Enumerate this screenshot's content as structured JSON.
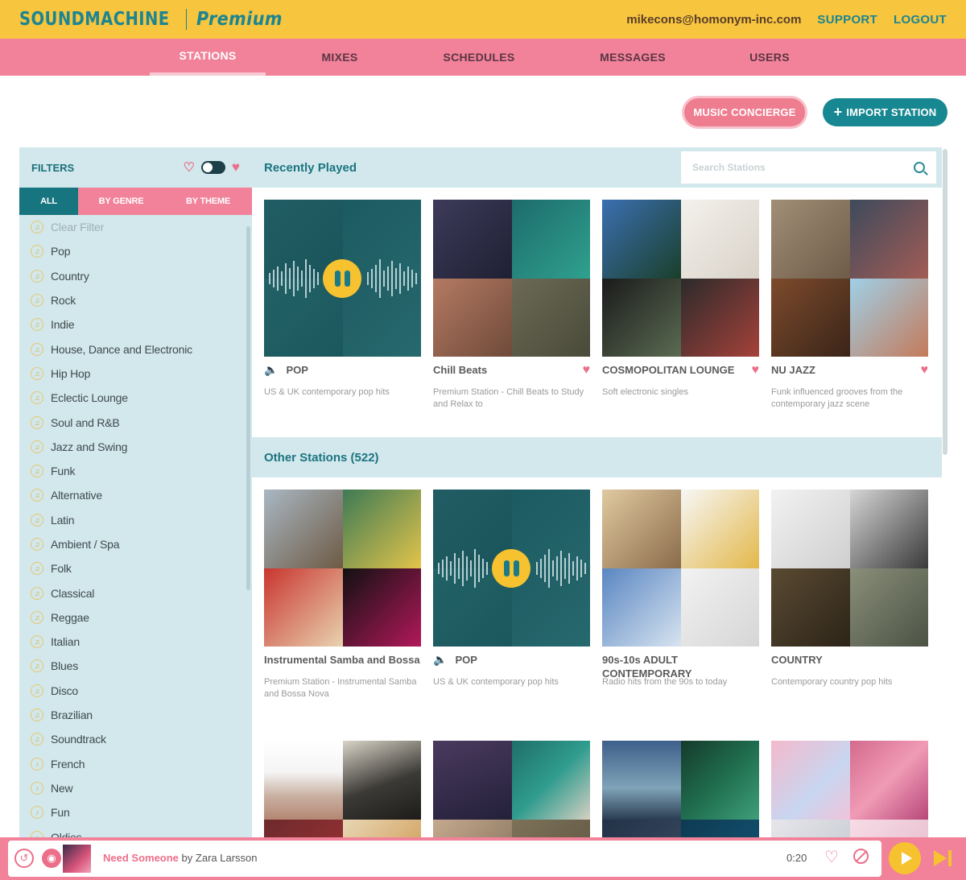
{
  "header": {
    "brand": "SOUNDMACHINE",
    "tier": "Premium",
    "email": "mikecons@homonym-inc.com",
    "support": "SUPPORT",
    "logout": "LOGOUT"
  },
  "nav": [
    "STATIONS",
    "MIXES",
    "SCHEDULES",
    "MESSAGES",
    "USERS"
  ],
  "actions": {
    "concierge": "MUSIC CONCIERGE",
    "import": "IMPORT STATION"
  },
  "filters": {
    "title": "FILTERS",
    "tabs": [
      "ALL",
      "BY GENRE",
      "BY THEME"
    ],
    "clear": "Clear Filter",
    "genres": [
      "Pop",
      "Country",
      "Rock",
      "Indie",
      "House, Dance and Electronic",
      "Hip Hop",
      "Eclectic Lounge",
      "Soul and R&B",
      "Jazz and Swing",
      "Funk",
      "Alternative",
      "Latin",
      "Ambient / Spa",
      "Folk",
      "Classical",
      "Reggae",
      "Italian",
      "Blues",
      "Disco",
      "Brazilian",
      "Soundtrack",
      "French",
      "New",
      "Fun",
      "Oldies"
    ]
  },
  "recent": {
    "title": "Recently Played",
    "search_placeholder": "Search Stations",
    "cards": [
      {
        "title": "POP",
        "desc": "US & UK contemporary pop hits"
      },
      {
        "title": "Chill Beats",
        "desc": "Premium Station - Chill Beats to Study and Relax to"
      },
      {
        "title": "COSMOPOLITAN LOUNGE",
        "desc": "Soft electronic singles"
      },
      {
        "title": "NU JAZZ",
        "desc": "Funk influenced grooves from the contemporary jazz scene"
      }
    ]
  },
  "other": {
    "title": "Other Stations (522)",
    "cards": [
      {
        "title": "Instrumental Samba and Bossa",
        "desc": "Premium Station - Instrumental Samba and Bossa Nova"
      },
      {
        "title": "POP",
        "desc": "US & UK contemporary pop hits"
      },
      {
        "title": "90s-10s ADULT CONTEMPORARY",
        "desc": "Radio hits from the 90s to today"
      },
      {
        "title": "COUNTRY",
        "desc": "Contemporary country pop hits"
      }
    ]
  },
  "player": {
    "song": "Need Someone",
    "by": "by",
    "artist": "Zara Larsson",
    "time": "0:20"
  },
  "colors": {
    "yellow": "#f7c53e",
    "pink": "#f1829a",
    "teal": "#1c8591",
    "panel": "#d2e8ec"
  }
}
